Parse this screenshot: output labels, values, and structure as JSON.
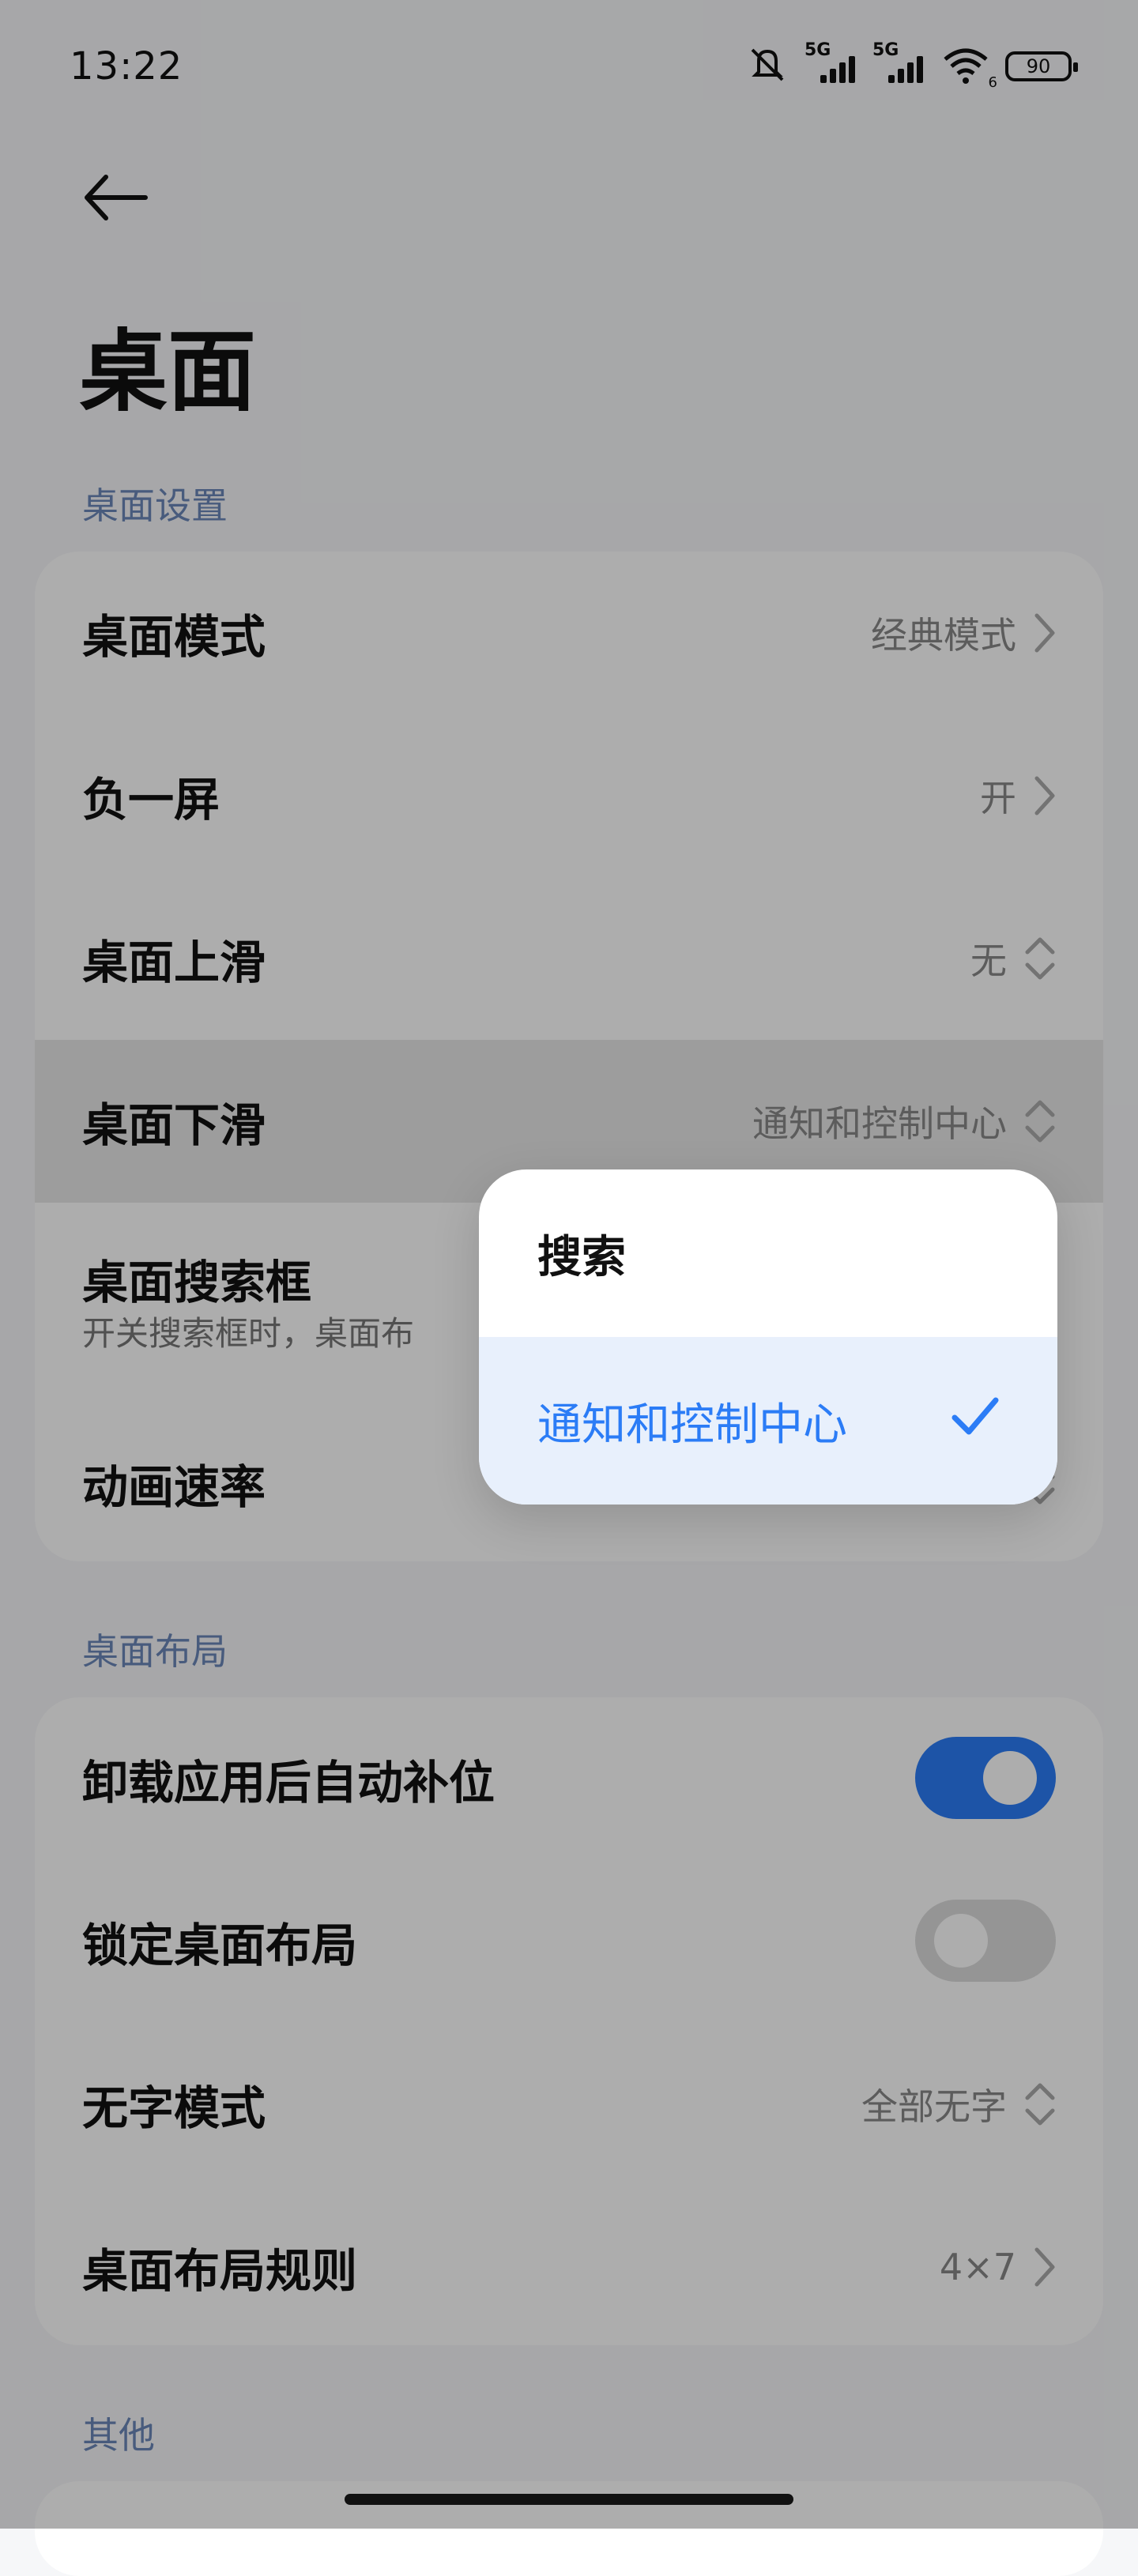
{
  "status_bar": {
    "time": "13:22",
    "signal1_label": "5G",
    "signal2_label": "5G",
    "wifi_badge": "6",
    "battery": "90"
  },
  "header": {
    "title": "桌面"
  },
  "sections": {
    "desktop_settings": "桌面设置",
    "desktop_layout": "桌面布局",
    "other": "其他"
  },
  "settings": {
    "desktop_mode": {
      "label": "桌面模式",
      "value": "经典模式"
    },
    "minus_one_screen": {
      "label": "负一屏",
      "value": "开"
    },
    "swipe_up": {
      "label": "桌面上滑",
      "value": "无"
    },
    "swipe_down": {
      "label": "桌面下滑",
      "value": "通知和控制中心"
    },
    "search_box": {
      "label": "桌面搜索框",
      "subtitle": "开关搜索框时，桌面布"
    },
    "animation_speed": {
      "label": "动画速率"
    }
  },
  "layout": {
    "auto_fill": {
      "label": "卸载应用后自动补位",
      "on": true
    },
    "lock_layout": {
      "label": "锁定桌面布局",
      "on": false
    },
    "no_text_mode": {
      "label": "无字模式",
      "value": "全部无字"
    },
    "layout_rule": {
      "label": "桌面布局规则",
      "value": "4×7"
    }
  },
  "dropdown": {
    "options": [
      "搜索",
      "通知和控制中心"
    ],
    "selected": "通知和控制中心"
  },
  "colors": {
    "accent": "#2b7cf6",
    "section_label": "#6a87b8"
  },
  "icons": [
    "back-arrow-icon",
    "chevron-right-icon",
    "up-down-chevron-icon",
    "check-icon",
    "wifi-icon",
    "mute-icon",
    "signal-icon"
  ]
}
